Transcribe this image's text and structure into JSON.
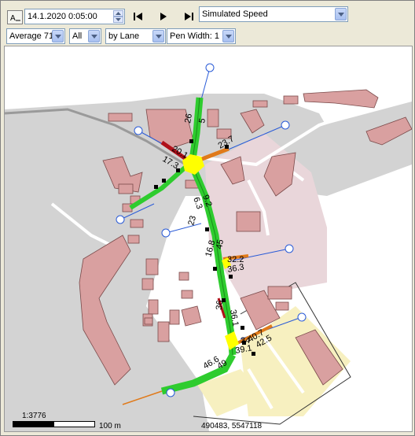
{
  "toolbar": {
    "datetime_value": "14.1.2020 0:05:00",
    "measure_selected": "Simulated Speed",
    "average_selected": "Average 71",
    "filter_selected": "All",
    "group_selected": "by Lane",
    "pen_width_selected": "Pen Width: 1"
  },
  "map": {
    "scale_ratio": "1:3776",
    "scale_distance": "100 m",
    "coordinates": "490483, 5547118",
    "labels": [
      {
        "text": "20.1"
      },
      {
        "text": "17.3"
      },
      {
        "text": "26"
      },
      {
        "text": "5"
      },
      {
        "text": "23.7"
      },
      {
        "text": "9.2"
      },
      {
        "text": "6.3"
      },
      {
        "text": "23"
      },
      {
        "text": "16.8"
      },
      {
        "text": "45"
      },
      {
        "text": "32.2"
      },
      {
        "text": "36.3"
      },
      {
        "text": "36"
      },
      {
        "text": "36.1"
      },
      {
        "text": "40.7"
      },
      {
        "text": "42.5"
      },
      {
        "text": "34"
      },
      {
        "text": "39.1"
      },
      {
        "text": "46.6"
      },
      {
        "text": "49"
      }
    ]
  },
  "colors": {
    "building": "#d9a0a0",
    "building_stroke": "#7a4a4a",
    "area_gray": "#d3d3d3",
    "area_pink": "#e9d6da",
    "area_yellow": "#f7f0c0",
    "road_white": "#ffffff",
    "speed_green": "#2ecc2e",
    "speed_orange": "#e07a1a",
    "speed_red": "#b0101a",
    "node_yellow": "#ffff00",
    "connector_blue": "#2a5bd7"
  },
  "icons": {
    "layer_button": "layers-icon",
    "first": "skip-back-icon",
    "play": "play-icon",
    "last": "skip-forward-icon"
  }
}
